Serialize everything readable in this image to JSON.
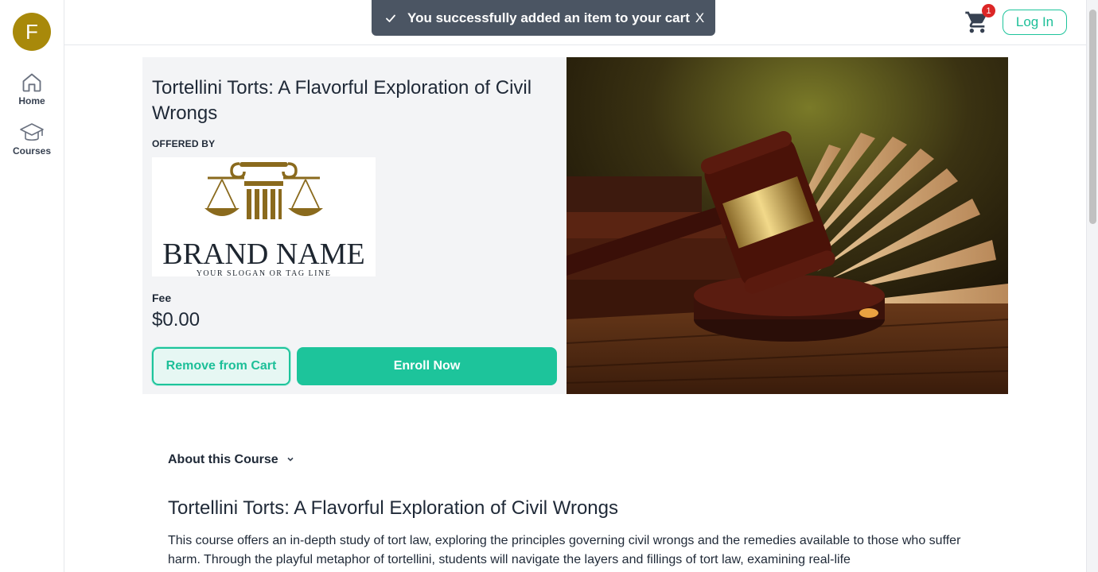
{
  "sidebar": {
    "avatar_letter": "F",
    "items": [
      {
        "label": "Home",
        "icon": "home-icon"
      },
      {
        "label": "Courses",
        "icon": "graduation-cap-icon"
      }
    ]
  },
  "header": {
    "cart_count": "1",
    "login_label": "Log In"
  },
  "toast": {
    "message": "You successfully added an item to your cart",
    "close_label": "X"
  },
  "course": {
    "title": "Tortellini Torts: A Flavorful Exploration of Civil Wrongs",
    "offered_by_label": "OFFERED BY",
    "brand_name": "BRAND NAME",
    "brand_slogan": "YOUR SLOGAN OR TAG LINE",
    "fee_label": "Fee",
    "fee_value": "$0.00",
    "remove_label": "Remove from Cart",
    "enroll_label": "Enroll Now"
  },
  "about": {
    "toggle_label": "About this Course",
    "title": "Tortellini Torts: A Flavorful Exploration of Civil Wrongs",
    "description": "This course offers an in-depth study of tort law, exploring the principles governing civil wrongs and the remedies available to those who suffer harm. Through the playful metaphor of tortellini, students will navigate the layers and fillings of tort law, examining real-life"
  },
  "colors": {
    "accent": "#1dc49b",
    "avatar": "#a8890a",
    "toast_bg": "#4b5563",
    "badge": "#dc2626"
  }
}
